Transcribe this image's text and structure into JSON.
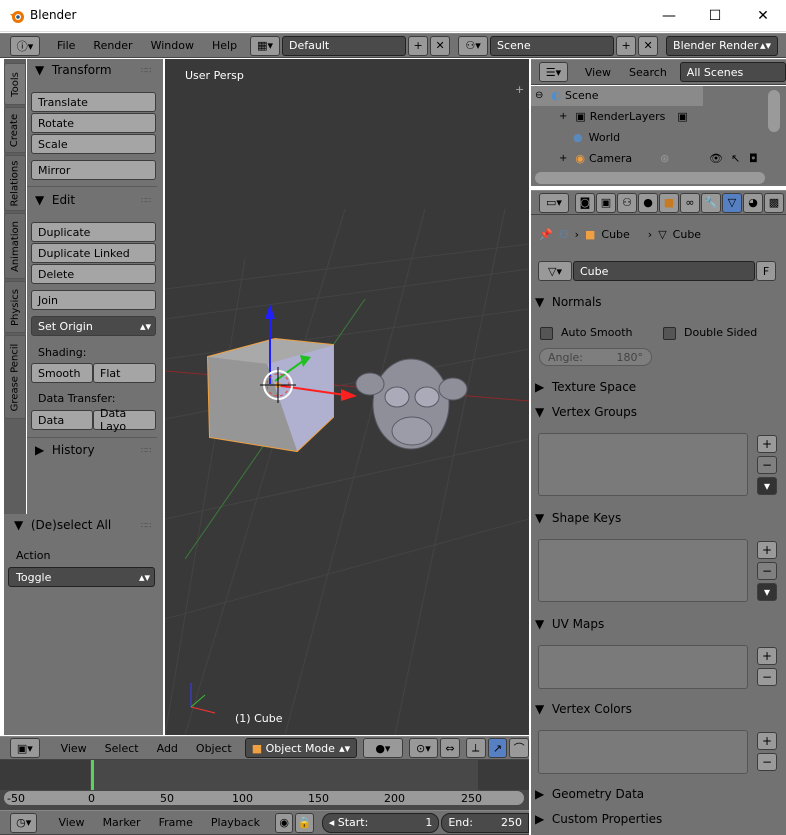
{
  "window": {
    "title": "Blender",
    "minimize": "—",
    "maximize": "☐",
    "close": "✕"
  },
  "info_bar": {
    "menus": [
      "File",
      "Render",
      "Window",
      "Help"
    ],
    "layout": "Default",
    "scene": "Scene",
    "engine": "Blender Render"
  },
  "outliner_header": {
    "view": "View",
    "search": "Search",
    "filter": "All Scenes"
  },
  "outliner": {
    "items": [
      {
        "label": "Scene"
      },
      {
        "label": "RenderLayers"
      },
      {
        "label": "World"
      },
      {
        "label": "Camera"
      }
    ]
  },
  "tabs": [
    "Tools",
    "Create",
    "Relations",
    "Animation",
    "Physics",
    "Grease Pencil"
  ],
  "tools": {
    "transform_title": "Transform",
    "translate": "Translate",
    "rotate": "Rotate",
    "scale": "Scale",
    "mirror": "Mirror",
    "edit_title": "Edit",
    "duplicate": "Duplicate",
    "duplicate_linked": "Duplicate Linked",
    "delete": "Delete",
    "join": "Join",
    "set_origin": "Set Origin",
    "shading_label": "Shading:",
    "smooth": "Smooth",
    "flat": "Flat",
    "data_transfer_label": "Data Transfer:",
    "data": "Data",
    "data_layo": "Data Layo",
    "history_title": "History"
  },
  "operator": {
    "title": "(De)select All",
    "action_label": "Action",
    "action_value": "Toggle"
  },
  "viewport": {
    "persp": "User Persp",
    "object_label": "(1) Cube"
  },
  "view3d_header": {
    "menus": [
      "View",
      "Select",
      "Add",
      "Object"
    ],
    "mode": "Object Mode"
  },
  "timeline": {
    "ticks": [
      "-50",
      "0",
      "50",
      "100",
      "150",
      "200",
      "250"
    ],
    "current_frame": 1
  },
  "timeline_header": {
    "menus": [
      "View",
      "Marker",
      "Frame",
      "Playback"
    ],
    "start_label": "Start:",
    "start_value": "1",
    "end_label": "End:",
    "end_value": "250"
  },
  "properties": {
    "breadcrumb_object": "Cube",
    "breadcrumb_mesh": "Cube",
    "mesh_name": "Cube",
    "fake_user": "F",
    "normals_title": "Normals",
    "auto_smooth": "Auto Smooth",
    "double_sided": "Double Sided",
    "angle": "Angle:",
    "angle_value": "180°",
    "texture_space": "Texture Space",
    "vertex_groups": "Vertex Groups",
    "shape_keys": "Shape Keys",
    "uv_maps": "UV Maps",
    "vertex_colors": "Vertex Colors",
    "geometry_data": "Geometry Data",
    "custom_properties": "Custom Properties"
  }
}
